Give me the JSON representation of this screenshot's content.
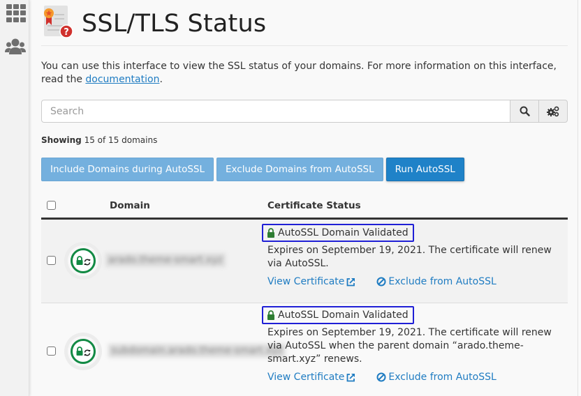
{
  "sidebar": {
    "items": [
      {
        "icon": "apps-grid-icon"
      },
      {
        "icon": "users-icon"
      }
    ]
  },
  "header": {
    "title": "SSL/TLS Status",
    "icon": "certificate-question-icon"
  },
  "description": {
    "text": "You can use this interface to view the SSL status of your domains. For more information on this interface, read the",
    "link_label": "documentation",
    "suffix": "."
  },
  "search": {
    "placeholder": "Search",
    "value": "",
    "search_icon": "search-icon",
    "settings_icon": "cogs-icon"
  },
  "showing": {
    "label": "Showing",
    "text": "15 of 15 domains"
  },
  "actions": {
    "include_label": "Include Domains during AutoSSL",
    "exclude_label": "Exclude Domains from AutoSSL",
    "run_label": "Run AutoSSL"
  },
  "table": {
    "columns": [
      "Domain",
      "Certificate Status"
    ],
    "rows": [
      {
        "domain": "arado.theme-smart.xyz",
        "status": "AutoSSL Domain Validated",
        "expires": "Expires on September 19, 2021. The certificate will renew via AutoSSL.",
        "view_label": "View Certificate",
        "exclude_label": "Exclude from AutoSSL"
      },
      {
        "domain": "subdomain.arado.theme-smart.xyz",
        "status": "AutoSSL Domain Validated",
        "expires": "Expires on September 19, 2021. The certificate will renew via AutoSSL when the parent domain “arado.theme-smart.xyz” renews.",
        "view_label": "View Certificate",
        "exclude_label": "Exclude from AutoSSL"
      }
    ]
  },
  "colors": {
    "primary": "#1f82c8",
    "primary_light": "#74b0de",
    "link": "#1f7cc2",
    "valid_green": "#128a44",
    "highlight_box": "#1f1fd6"
  }
}
